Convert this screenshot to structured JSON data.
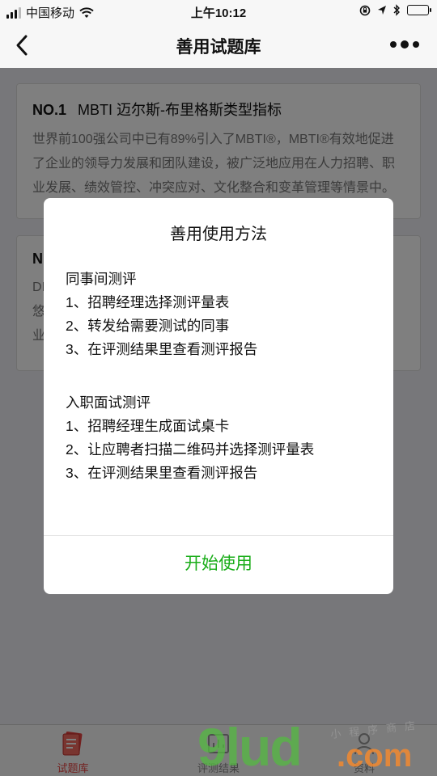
{
  "status": {
    "carrier": "中国移动",
    "time": "上午10:12"
  },
  "nav": {
    "title": "善用试题库",
    "back_icon": "chevron-left-icon",
    "more_icon": "more-dots-icon"
  },
  "cards": [
    {
      "number": "NO.1",
      "title": "MBTI 迈尔斯-布里格斯类型指标",
      "desc": "世界前100强公司中已有89%引入了MBTI®，MBTI®有效地促进了企业的领导力发展和团队建设，被广泛地应用在人力招聘、职业发展、绩效管控、冲突应对、文化整合和变革管理等情景中。"
    },
    {
      "number": "N",
      "desc_lines": [
        "DI",
        "悠",
        "业"
      ]
    }
  ],
  "modal": {
    "title": "善用使用方法",
    "sections": [
      {
        "heading": "同事间测评",
        "steps": [
          "1、招聘经理选择测评量表",
          "2、转发给需要测试的同事",
          "3、在评测结果里查看测评报告"
        ]
      },
      {
        "heading": "入职面试测评",
        "steps": [
          "1、招聘经理生成面试桌卡",
          "2、让应聘者扫描二维码并选择测评量表",
          "3、在评测结果里查看测评报告"
        ]
      }
    ],
    "button_label": "开始使用",
    "accent": "#1aad19"
  },
  "tabs": [
    {
      "label": "试题库",
      "icon": "book-icon",
      "active": true
    },
    {
      "label": "评测结果",
      "icon": "chart-icon",
      "active": false
    },
    {
      "label": "资料",
      "icon": "profile-icon",
      "active": false
    }
  ],
  "watermark": {
    "big": "9lud",
    "com": ".com",
    "small": "小程序商店"
  },
  "colors": {
    "active_tab": "#e64340",
    "accent_green": "#1aad19"
  }
}
